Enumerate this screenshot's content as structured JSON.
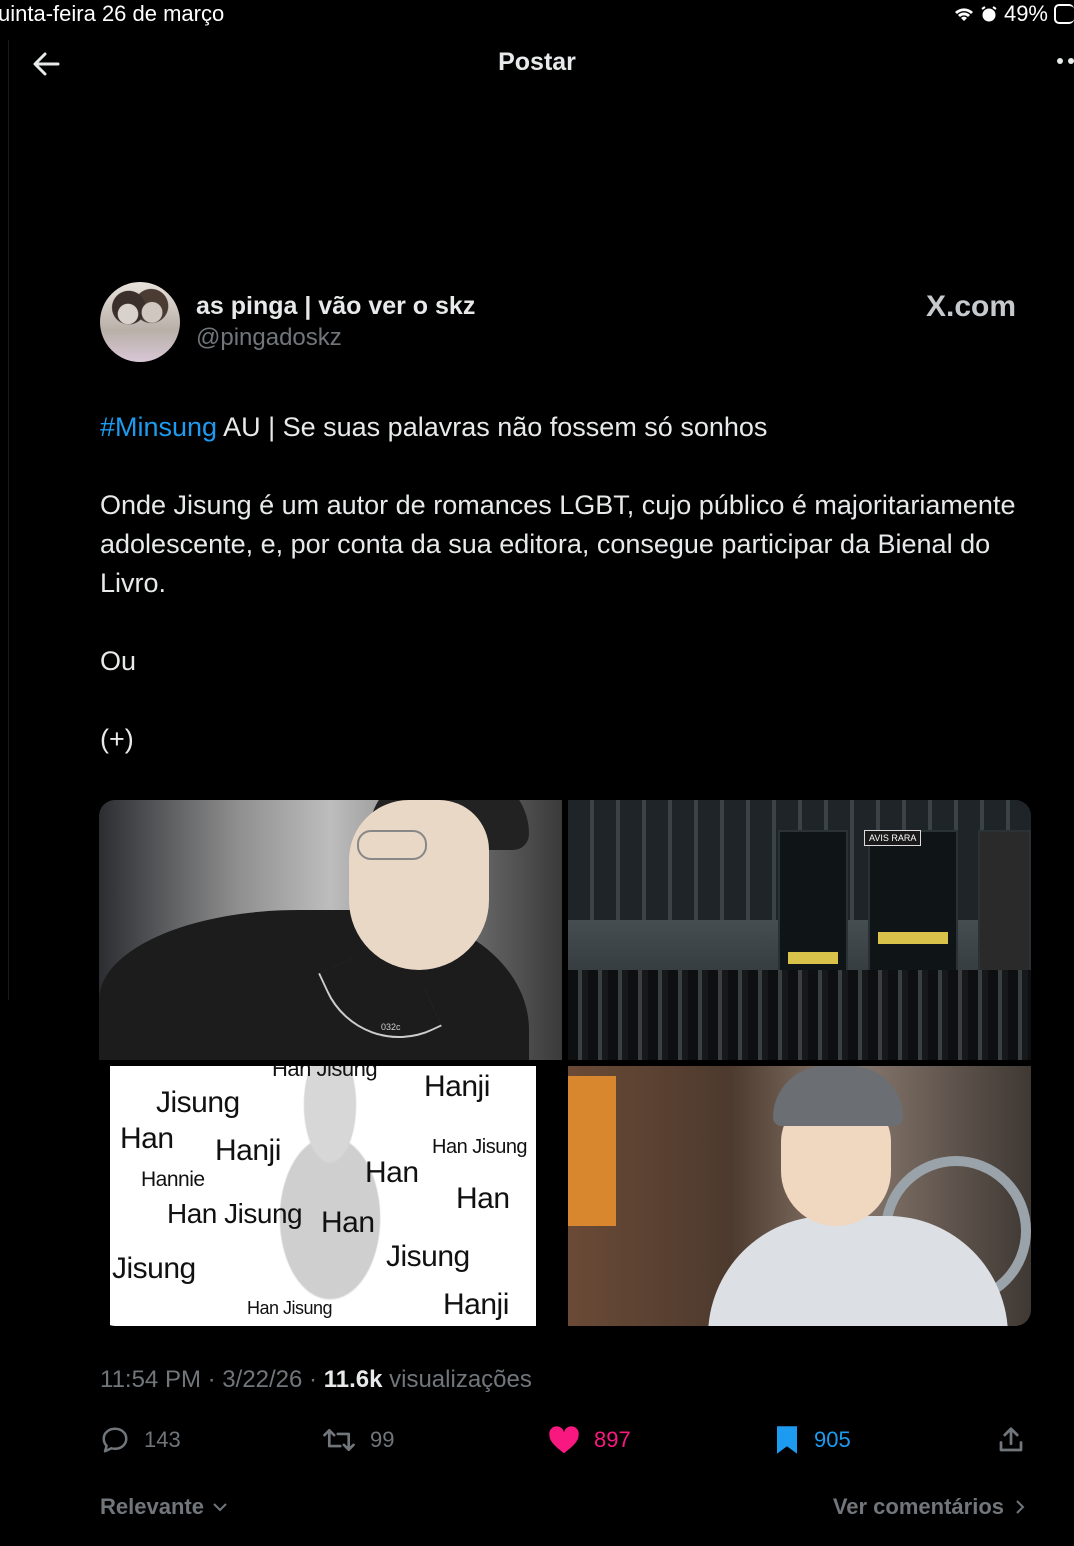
{
  "status_bar": {
    "date": "uinta-feira 26 de março",
    "battery": "49%"
  },
  "header": {
    "title": "Postar"
  },
  "author": {
    "name": "as pinga | vão ver o skz",
    "handle": "@pingadoskz",
    "source": "X.com"
  },
  "post": {
    "hashtag": "#Minsung",
    "line1_rest": " AU | Se suas palavras não fossem só sonhos",
    "paragraph2": "Onde Jisung é um autor de romances LGBT, cujo público é majoritariamente adolescente, e, por conta da sua editora, consegue participar da Bienal do Livro.",
    "paragraph3": "Ou",
    "paragraph4": "(+)"
  },
  "media": {
    "image1_text": "032c",
    "image2_text": "AVIS RARA",
    "meme_words": [
      "Han Jisung",
      "Hanji",
      "Jisung",
      "Han",
      "Hanji",
      "Han Jisung",
      "Hannie",
      "Han",
      "Han",
      "Han Jisung",
      "Han",
      "Jisung",
      "Jisung",
      "Han Jisung",
      "Hanji"
    ]
  },
  "meta": {
    "time": "11:54 PM",
    "date": "3/22/26",
    "views_count": "11.6k",
    "views_label": "visualizações"
  },
  "actions": {
    "replies": "143",
    "reposts": "99",
    "likes": "897",
    "bookmarks": "905"
  },
  "footer": {
    "sort_label": "Relevante",
    "comments_link": "Ver comentários"
  },
  "colors": {
    "background": "#000000",
    "accent": "#1d9bf0",
    "like": "#f91880",
    "muted": "#71767b"
  }
}
